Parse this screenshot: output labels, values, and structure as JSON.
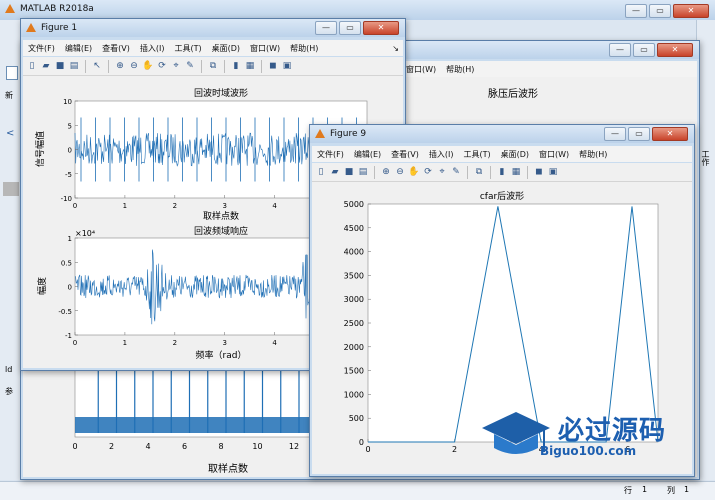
{
  "main_window": {
    "title": "MATLAB R2018a",
    "left_tool_label": "新",
    "right_tab_label": "工作",
    "bottom_left_label": "ld",
    "bottom_left_label2": "参"
  },
  "status_bar": {
    "row_label": "行",
    "row_value": "1",
    "col_label": "列",
    "col_value": "1"
  },
  "menu_items": [
    "文件(F)",
    "编辑(E)",
    "查看(V)",
    "插入(I)",
    "工具(T)",
    "桌面(D)",
    "窗口(W)",
    "帮助(H)"
  ],
  "figure1": {
    "title": "Figure 1",
    "plot1": {
      "title": "回波时域波形",
      "xlabel": "取样点数",
      "ylabel": "信号幅值",
      "yticks": [
        "10",
        "5",
        "0",
        "-5",
        "-10"
      ],
      "xticks": [
        "0",
        "1",
        "2",
        "3",
        "4",
        "5"
      ]
    },
    "plot2": {
      "title": "回波频域响应",
      "xlabel": "频率（rad）",
      "ylabel": "幅度",
      "exponent": "×10⁴",
      "yticks": [
        "1",
        "0.5",
        "0",
        "-0.5",
        "-1"
      ],
      "xticks": [
        "0",
        "1",
        "2",
        "3",
        "4",
        "5"
      ]
    }
  },
  "figure_back": {
    "plot_title": "脉压后波形",
    "xlabel": "取样点数",
    "xticks": [
      "0",
      "2",
      "4",
      "6",
      "8",
      "10",
      "12"
    ]
  },
  "figure9": {
    "title": "Figure 9",
    "plot": {
      "title": "cfar后波形",
      "yticks": [
        "5000",
        "4500",
        "4000",
        "3500",
        "3000",
        "2500",
        "2000",
        "1500",
        "1000",
        "500",
        "0"
      ],
      "xticks": [
        "0",
        "2",
        "4",
        "6"
      ]
    }
  },
  "chart_data": [
    {
      "type": "line",
      "title": "回波时域波形",
      "xlabel": "取样点数",
      "ylabel": "信号幅值",
      "ylim": [
        -10,
        10
      ],
      "xlim": [
        0,
        6
      ],
      "description_values": "noise band approx ±3 with spikes to ±7"
    },
    {
      "type": "line",
      "title": "回波频域响应",
      "xlabel": "频率（rad）",
      "ylabel": "幅度",
      "ylim": [
        -1,
        1
      ],
      "xlim": [
        0,
        6
      ],
      "y_multiplier": "×10⁴",
      "peaks": [
        {
          "x": 1.6,
          "y": 0.9
        },
        {
          "x": 4.7,
          "y": 0.9
        }
      ]
    },
    {
      "type": "line",
      "title": "cfar后波形",
      "ylim": [
        0,
        5000
      ],
      "xlim": [
        0,
        6.7
      ],
      "x": [
        0,
        2.0,
        3.0,
        4.0,
        5.5,
        6.1,
        6.7
      ],
      "y": [
        0,
        0,
        4950,
        0,
        0,
        4950,
        0
      ]
    },
    {
      "type": "line",
      "title": "脉压后波形",
      "xlabel": "取样点数",
      "xlim": [
        0,
        16
      ],
      "spikes_x": [
        1,
        2,
        3,
        4,
        5,
        6,
        7,
        8,
        9,
        10,
        11,
        12,
        13,
        14,
        15,
        16
      ]
    }
  ],
  "watermark": {
    "brand": "必过源码",
    "site": "Biguo100.com"
  }
}
